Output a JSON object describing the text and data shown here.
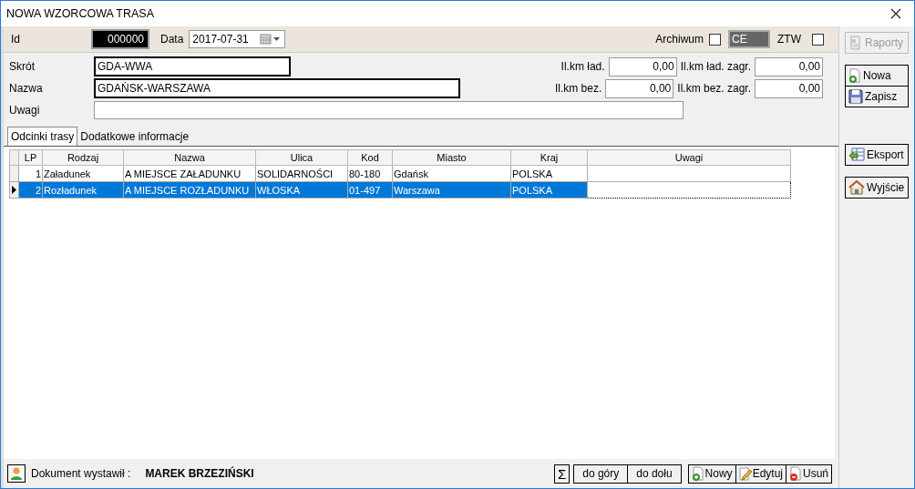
{
  "window": {
    "title": "NOWA WZORCOWA TRASA"
  },
  "header": {
    "id": {
      "label": "Id",
      "value": "000000"
    },
    "date": {
      "label": "Data",
      "value": "2017-07-31"
    },
    "archiwum": {
      "label": "Archiwum",
      "checked": false
    },
    "code": {
      "value": "CE"
    },
    "ztw": {
      "label": "ZTW",
      "checked": false
    }
  },
  "fields": [
    {
      "label": "Skrót",
      "value": "GDA-WWA"
    },
    {
      "label": "Nazwa",
      "value": "GDAŃSK-WARSZAWA"
    },
    {
      "label": "Uwagi"
    }
  ],
  "km_fields": [
    {
      "label": "Il.km ład.",
      "value": "0,00"
    },
    {
      "label": "Il.km ład. zagr.",
      "value": "0,00"
    },
    {
      "label": "Il.km bez.",
      "value": "0,00"
    },
    {
      "label": "Il.km bez. zagr.",
      "value": "0,00"
    }
  ],
  "tabs": [
    {
      "label": "Odcinki trasy",
      "selected": true
    },
    {
      "label": "Dodatkowe informacje",
      "selected": false
    }
  ],
  "table": {
    "columns": [
      "LP",
      "Rodzaj",
      "Nazwa",
      "Ulica",
      "Kod",
      "Miasto",
      "Kraj",
      "Uwagi"
    ],
    "rows": [
      {
        "selected": false,
        "cells": [
          "1",
          "Załadunek",
          "A MIEJSCE ZAŁADUNKU",
          "SOLIDARNOŚCI",
          "80-180",
          "Gdańsk",
          "POLSKA",
          ""
        ]
      },
      {
        "selected": true,
        "cells": [
          "2",
          "Rozładunek",
          "A MIEJSCE ROZŁADUNKU",
          "WŁOSKA",
          "01-497",
          "Warszawa",
          "POLSKA",
          ""
        ]
      }
    ]
  },
  "footer": {
    "author_label": "Dokument wystawił :",
    "author_name": "MAREK BRZEZIŃSKI",
    "sum_button": "Σ",
    "move_buttons": [
      "do góry",
      "do dołu"
    ],
    "row_buttons": [
      {
        "label": "Nowy",
        "kind": "new"
      },
      {
        "label": "Edytuj",
        "kind": "edit"
      },
      {
        "label": "Usuń",
        "kind": "delete"
      }
    ]
  },
  "sidebar": [
    {
      "label": "Raporty",
      "kind": "report",
      "disabled": true
    },
    {
      "label": "Nowa",
      "kind": "new",
      "disabled": false
    },
    {
      "label": "Zapisz",
      "kind": "save",
      "disabled": false
    },
    {
      "label": "Eksport",
      "kind": "export",
      "disabled": false
    },
    {
      "label": "Wyjście",
      "kind": "exit",
      "disabled": false
    }
  ]
}
